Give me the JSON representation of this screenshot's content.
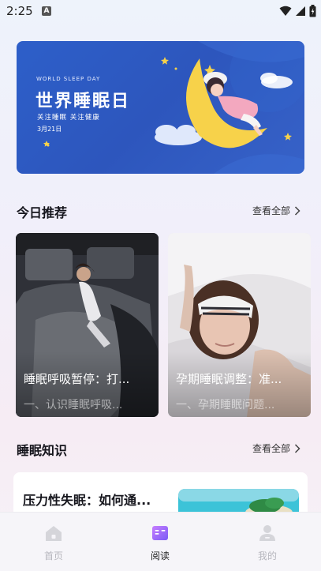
{
  "status_bar": {
    "time": "2:25",
    "notification_badge": "A",
    "icons": [
      "wifi-icon",
      "signal-icon",
      "battery-icon"
    ]
  },
  "banner": {
    "subtitle": "WORLD SLEEP DAY",
    "title": "世界睡眠日",
    "tagline": "关注睡眠 关注健康",
    "date": "3月21日"
  },
  "today": {
    "section_title": "今日推荐",
    "see_all": "查看全部",
    "cards": [
      {
        "title": "睡眠呼吸暂停：打...",
        "subtitle": "一、认识睡眠呼吸..."
      },
      {
        "title": "孕期睡眠调整：准...",
        "subtitle": "一、孕期睡眠问题..."
      }
    ]
  },
  "knowledge": {
    "section_title": "睡眠知识",
    "see_all": "查看全部",
    "items": [
      {
        "title": "压力性失眠：如何通..."
      }
    ]
  },
  "bottom_nav": {
    "items": [
      {
        "label": "首页",
        "icon": "home-icon",
        "active": false
      },
      {
        "label": "阅读",
        "icon": "book-icon",
        "active": true
      },
      {
        "label": "我的",
        "icon": "profile-icon",
        "active": false
      }
    ]
  },
  "colors": {
    "banner_blue": "#2d5fc9",
    "moon_yellow": "#f7d24a",
    "active_nav": "#8b5cf6",
    "inactive_nav": "#c8c8cf"
  }
}
